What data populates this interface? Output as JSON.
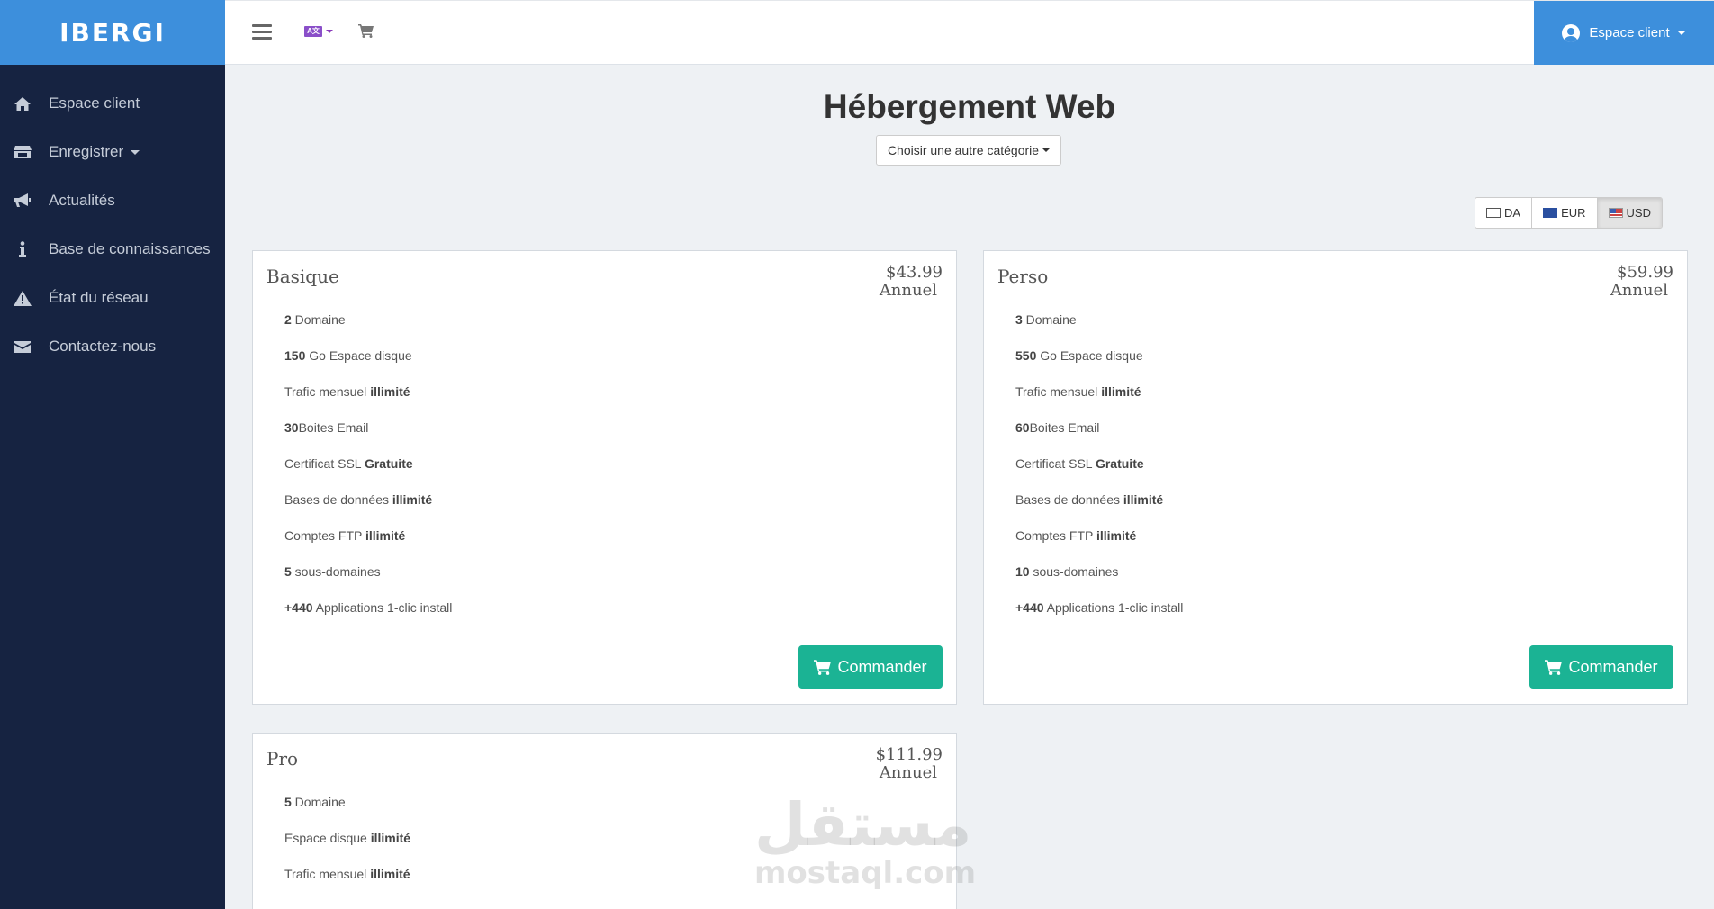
{
  "brand": {
    "name": "IBERGI"
  },
  "sidebar": {
    "items": [
      {
        "label": "Espace client",
        "icon": "home-icon"
      },
      {
        "label": "Enregistrer",
        "icon": "store-icon",
        "has_dropdown": true
      },
      {
        "label": "Actualités",
        "icon": "megaphone-icon"
      },
      {
        "label": "Base de connaissances",
        "icon": "info-icon"
      },
      {
        "label": "État du réseau",
        "icon": "warning-icon"
      },
      {
        "label": "Contactez-nous",
        "icon": "envelope-icon"
      }
    ]
  },
  "topbar": {
    "language_icon": "language-icon",
    "cart_icon": "cart-icon",
    "client_menu_label": "Espace client"
  },
  "main": {
    "title": "Hébergement Web",
    "category_button": "Choisir une autre catégorie",
    "currencies": [
      {
        "label": "DA",
        "active": false
      },
      {
        "label": "EUR",
        "active": false
      },
      {
        "label": "USD",
        "active": true
      }
    ]
  },
  "products": [
    {
      "name": "Basique",
      "price": "$43.99",
      "cycle": "Annuel",
      "order_label": "Commander",
      "features": [
        {
          "bold": "2",
          "text": " Domaine"
        },
        {
          "bold": "150",
          "text": " Go Espace disque"
        },
        {
          "text": "Trafic mensuel ",
          "bold_after": "illimité"
        },
        {
          "bold": "30",
          "text": "Boites Email"
        },
        {
          "text": "Certificat SSL ",
          "bold_after": "Gratuite"
        },
        {
          "text": "Bases de données ",
          "bold_after": "illimité"
        },
        {
          "text": "Comptes FTP ",
          "bold_after": "illimité"
        },
        {
          "bold": "5",
          "text": " sous-domaines"
        },
        {
          "bold": "+440",
          "text": " Applications 1-clic install"
        }
      ]
    },
    {
      "name": "Perso",
      "price": "$59.99",
      "cycle": "Annuel",
      "order_label": "Commander",
      "features": [
        {
          "bold": "3",
          "text": " Domaine"
        },
        {
          "bold": "550",
          "text": " Go Espace disque"
        },
        {
          "text": "Trafic mensuel ",
          "bold_after": "illimité"
        },
        {
          "bold": "60",
          "text": "Boites Email"
        },
        {
          "text": "Certificat SSL ",
          "bold_after": "Gratuite"
        },
        {
          "text": "Bases de données ",
          "bold_after": "illimité"
        },
        {
          "text": "Comptes FTP ",
          "bold_after": "illimité"
        },
        {
          "bold": "10",
          "text": " sous-domaines"
        },
        {
          "bold": "+440",
          "text": " Applications 1-clic install"
        }
      ]
    },
    {
      "name": "Pro",
      "price": "$111.99",
      "cycle": "Annuel",
      "features": [
        {
          "bold": "5",
          "text": " Domaine"
        },
        {
          "text": "Espace disque ",
          "bold_after": "illimité"
        },
        {
          "text": "Trafic mensuel ",
          "bold_after": "illimité"
        }
      ]
    }
  ],
  "watermark": {
    "arabic": "مستقل",
    "latin": "mostaql.com"
  },
  "colors": {
    "brand_blue": "#3d8fdc",
    "sidebar_bg": "#162341",
    "order_green": "#1bb394"
  }
}
